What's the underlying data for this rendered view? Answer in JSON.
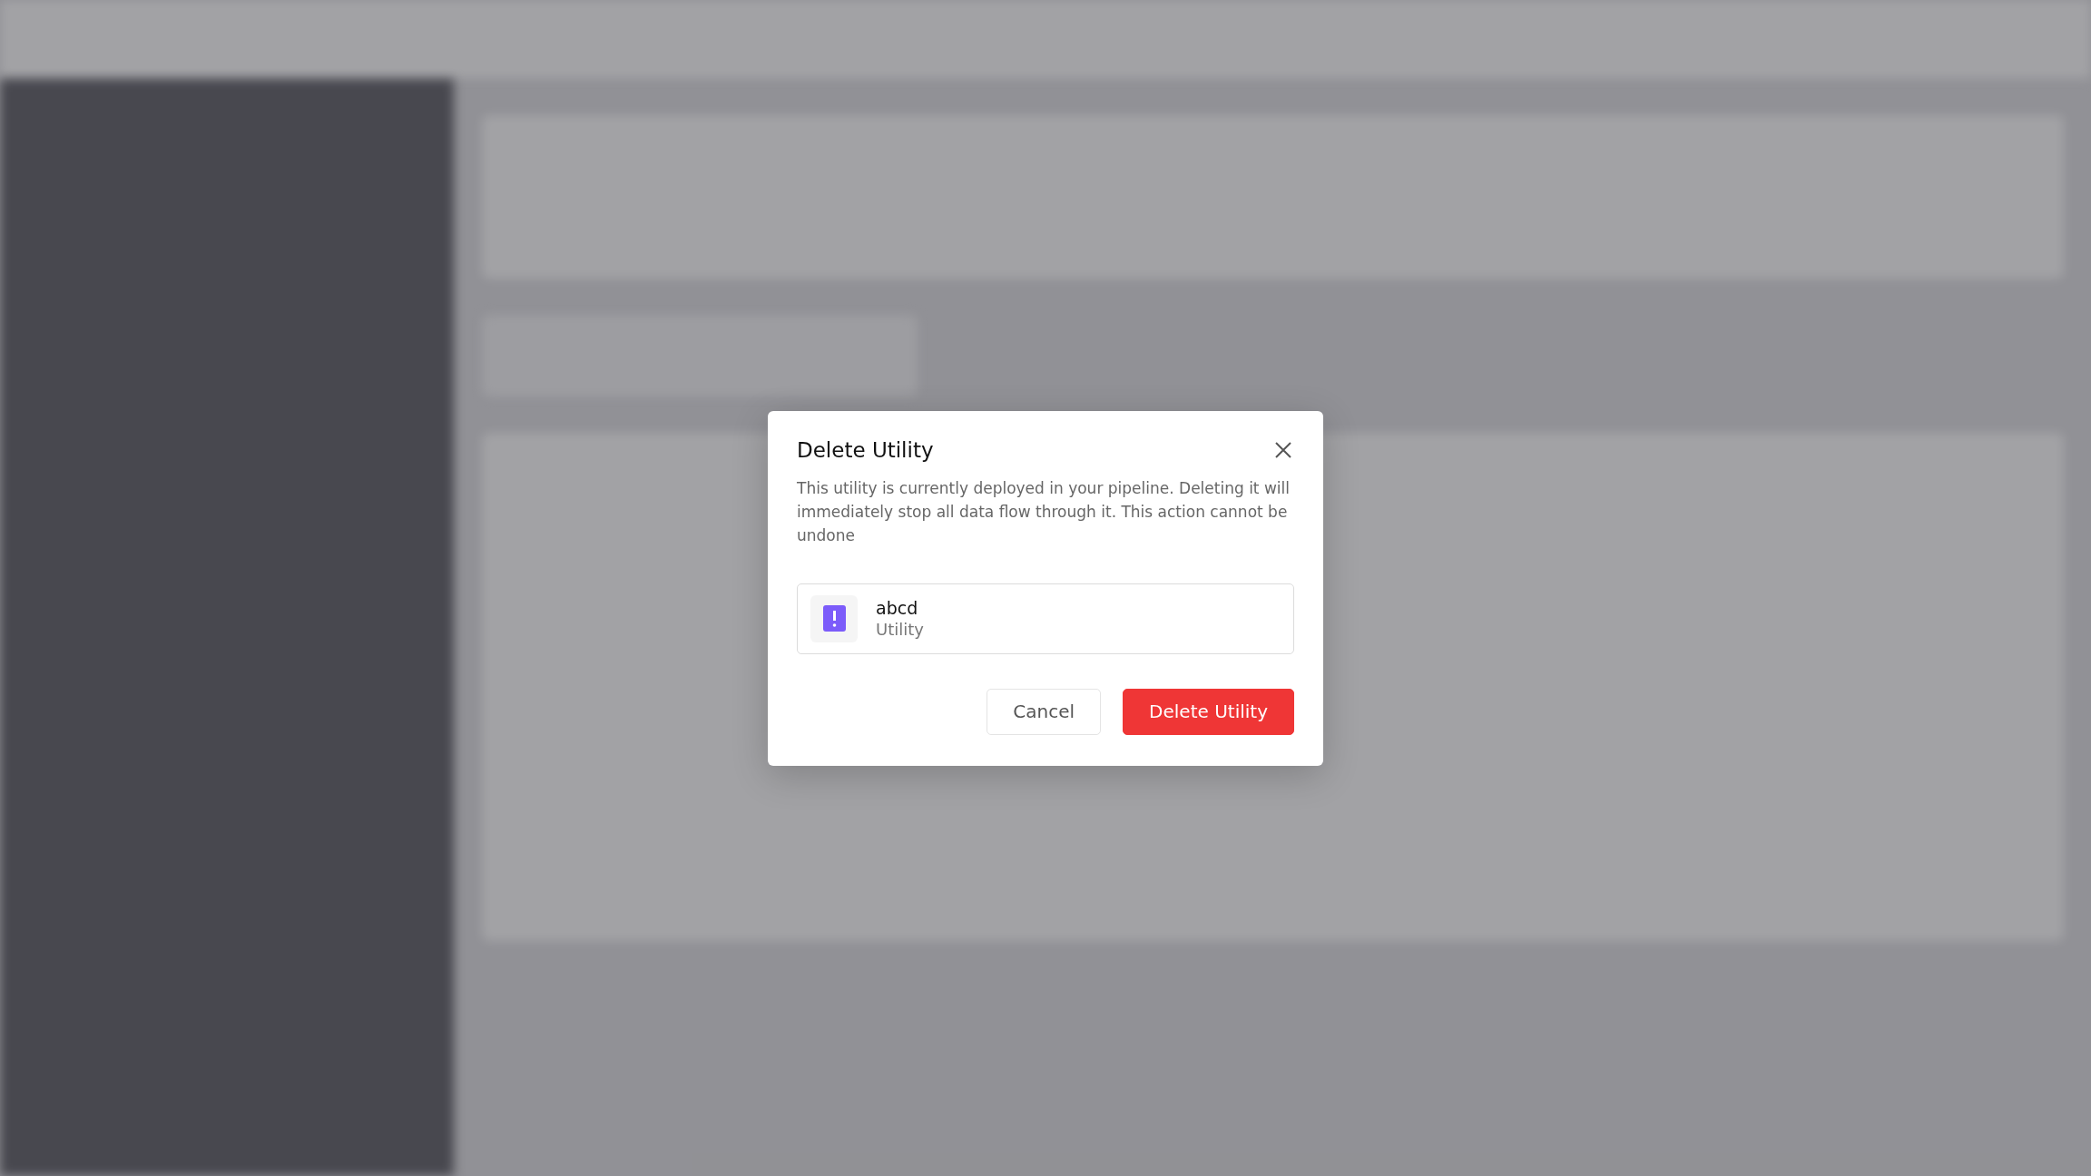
{
  "dialog": {
    "title": "Delete Utility",
    "message": "This utility is currently deployed in your pipeline. Deleting it will immediately stop all data flow through it. This action cannot be undone",
    "item": {
      "name": "abcd",
      "type": "Utility"
    },
    "buttons": [
      {
        "label": "Cancel",
        "kind": "secondary"
      },
      {
        "label": "Delete Utility",
        "kind": "danger"
      }
    ]
  }
}
